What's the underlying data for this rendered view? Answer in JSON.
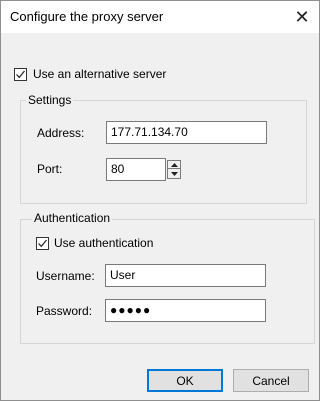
{
  "dialog": {
    "title": "Configure the proxy server",
    "close_glyph": "✕"
  },
  "alternative_server": {
    "label": "Use an alternative server",
    "checked": true
  },
  "settings": {
    "group_title": "Settings",
    "address_label": "Address:",
    "address_value": "177.71.134.70",
    "port_label": "Port:",
    "port_value": "80"
  },
  "authentication": {
    "group_title": "Authentication",
    "use_auth_label": "Use authentication",
    "use_auth_checked": true,
    "username_label": "Username:",
    "username_value": "User",
    "password_label": "Password:",
    "password_value": "●●●●●"
  },
  "buttons": {
    "ok_label": "OK",
    "cancel_label": "Cancel"
  },
  "colors": {
    "accent": "#0078d7",
    "dialog_background": "#f0f0f0"
  }
}
